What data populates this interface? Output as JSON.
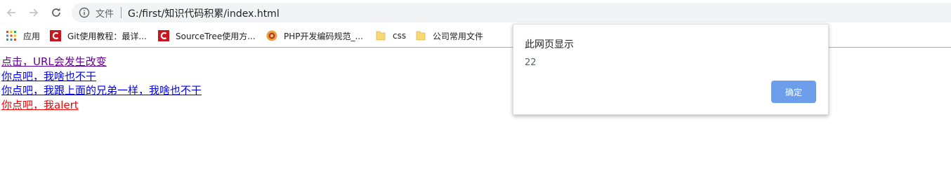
{
  "address_bar": {
    "scheme_label": "文件",
    "url": "G:/first/知识代码积累/index.html"
  },
  "bookmarks": [
    {
      "label": "应用",
      "icon": "apps-grid-icon"
    },
    {
      "label": "Git使用教程：最详...",
      "icon": "csdn-c-icon"
    },
    {
      "label": "SourceTree使用方...",
      "icon": "csdn-c-icon"
    },
    {
      "label": "PHP开发编码规范_...",
      "icon": "site-badge-icon"
    },
    {
      "label": "css",
      "icon": "folder-icon"
    },
    {
      "label": "公司常用文件",
      "icon": "folder-icon"
    }
  ],
  "page": {
    "links": [
      {
        "text": "点击，URL会发生改变",
        "color": "#660099"
      },
      {
        "text": "你点吧，我啥也不干",
        "color": "#0000ee"
      },
      {
        "text": "你点吧，我跟上面的兄弟一样，我啥也不干",
        "color": "#0000ee"
      },
      {
        "text": "你点吧，我alert",
        "color": "#ff0000"
      }
    ]
  },
  "dialog": {
    "title": "此网页显示",
    "message": "22",
    "ok_label": "确定",
    "ok_color": "#6d9eeb"
  }
}
